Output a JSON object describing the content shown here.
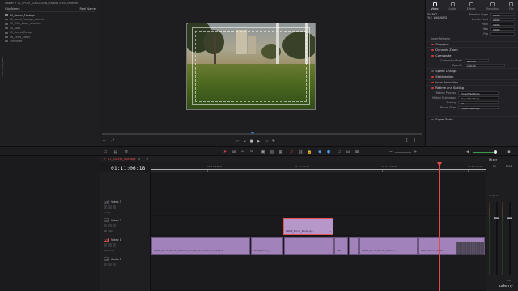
{
  "media_pool": {
    "breadcrumb": "Master > 01_SPORT_EDUCATION_Projects > 04_Timeline",
    "col_name": "Clip Name",
    "col_right": "Reel Name",
    "bins": [
      {
        "label": "01_Soccer_Footage",
        "selected": true
      },
      {
        "label": "02_Aerial_Footage_selects",
        "selected": false
      },
      {
        "label": "03_With_Video_selected",
        "selected": false
      },
      {
        "label": "04_Loop",
        "selected": false
      },
      {
        "label": "05_Sound_Design",
        "selected": false
      },
      {
        "label": "06_Titles_Lower",
        "selected": false
      },
      {
        "label": "Timelines",
        "selected": false
      }
    ],
    "side_tab": "EDIT_SUB_BINS"
  },
  "inspector": {
    "tabs": [
      {
        "label": "Video",
        "icon": "film-icon",
        "active": true
      },
      {
        "label": "Audio",
        "icon": "speaker-icon",
        "active": false
      },
      {
        "label": "Effects",
        "icon": "fx-icon",
        "active": false
      },
      {
        "label": "Transition",
        "icon": "transition-icon",
        "active": false
      },
      {
        "label": "File",
        "icon": "file-icon",
        "active": false
      }
    ],
    "zoom_text": "SECRET FILE_WARNING",
    "rows": [
      {
        "label": "Rotation Angle",
        "value": "0.000"
      },
      {
        "label": "Anchor Point",
        "value": "0.000"
      },
      {
        "label": "Pitch",
        "value": "0.000"
      },
      {
        "label": "Yaw",
        "value": "0.000"
      },
      {
        "label": "Flip",
        "value": ""
      }
    ],
    "smart_reframe": "Smart Reframe",
    "sections": [
      {
        "label": "Cropping",
        "on": true
      },
      {
        "label": "Dynamic Zoom",
        "on": true
      },
      {
        "label": "Composite",
        "on": true
      }
    ],
    "composite_rows": [
      {
        "label": "Composite Mode",
        "value": "Normal"
      },
      {
        "label": "Opacity",
        "value": "100.00"
      }
    ],
    "sections2": [
      {
        "label": "Speed Change",
        "on": false
      },
      {
        "label": "Stabilization",
        "on": true
      },
      {
        "label": "Lens Correction",
        "on": true
      },
      {
        "label": "Retime and Scaling",
        "on": true
      }
    ],
    "retime_rows": [
      {
        "label": "Retime Process",
        "value": "Project Settings"
      },
      {
        "label": "Motion Estimation",
        "value": "Project Settings"
      },
      {
        "label": "Scaling",
        "value": "Fill"
      },
      {
        "label": "Resize Filter",
        "value": "Project Settings"
      }
    ],
    "super_scale": "Super Scale"
  },
  "timeline": {
    "tab_name": "01_Soccer_Footage",
    "timecode": "01:11:06:18",
    "ruler_ticks": [
      "01:10:58:00",
      "01:11:00:00",
      "01:11:02:00",
      "01:11:04:00"
    ],
    "tracks": [
      {
        "id": "V3",
        "name": "Video 3",
        "count": "0 Clip",
        "active": false
      },
      {
        "id": "V2",
        "name": "Video 2",
        "count": "36 Clips",
        "active": false
      },
      {
        "id": "V1",
        "name": "Video 1",
        "count": "205 Clips",
        "active": true
      },
      {
        "id": "A1",
        "name": "Audio 1",
        "count": "",
        "active": false
      }
    ],
    "clips_v2": [
      {
        "label": "C0023_Soccer_Warm_up..."
      }
    ],
    "clips_v1": [
      {
        "label": "C0023_Soccer_Warm_up_Tracks_Cells_By_Oses_Other_b-Roll_Med..."
      },
      {
        "label": "C0023_Soccer_..."
      },
      {
        "label": ""
      },
      {
        "label": "C00..."
      },
      {
        "label": ""
      },
      {
        "label": "C0023_Soccer_Warm_up_Tracks..."
      },
      {
        "label": "C0023_Soccer_Warm..."
      }
    ]
  },
  "mixer": {
    "title": "Mixer",
    "channels": [
      {
        "label": "A1"
      },
      {
        "label": "Bus1"
      }
    ],
    "channel_name": "Audio 1",
    "db": "0.0"
  },
  "watermark": "udemy",
  "colors": {
    "clip": "#a283b9",
    "playhead": "#e14a4a",
    "accent": "#4a93e0"
  }
}
